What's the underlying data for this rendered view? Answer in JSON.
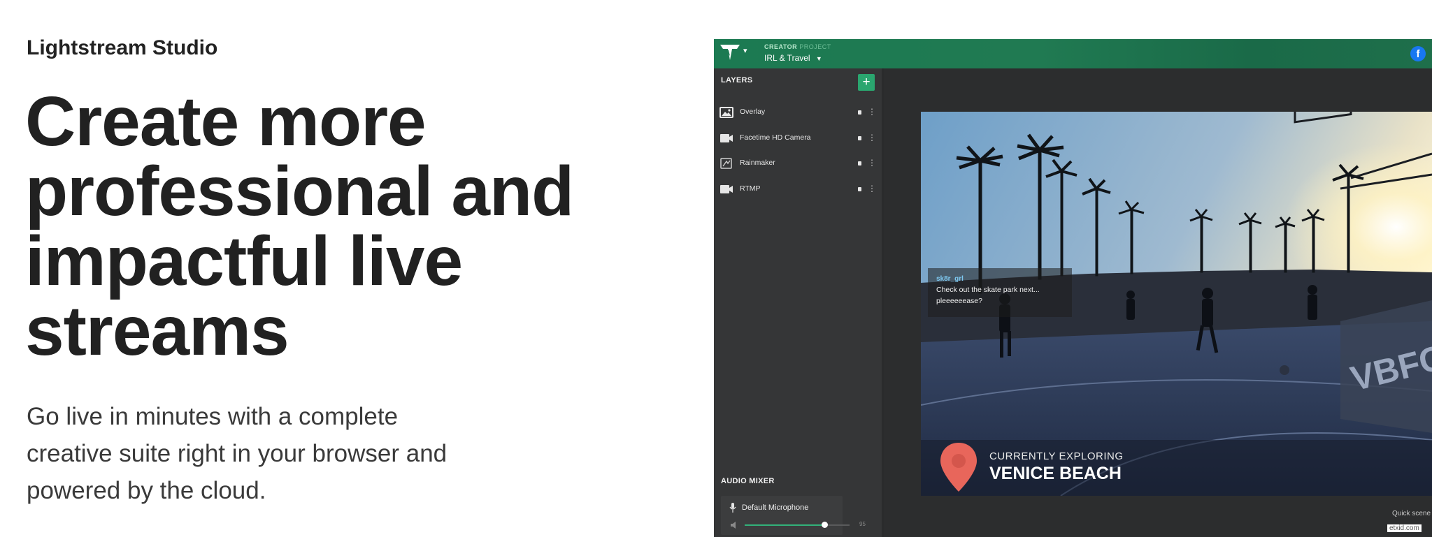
{
  "hero": {
    "eyebrow": "Lightstream Studio",
    "headline_lines": [
      "Create more",
      "professional and",
      "impactful live",
      "streams"
    ],
    "lede_lines": [
      "Go live in minutes with a complete",
      "creative suite right in your browser and",
      "powered by the cloud."
    ]
  },
  "app": {
    "project_kicker_strong": "CREATOR",
    "project_kicker_dim": "PROJECT",
    "project_name": "IRL & Travel",
    "fb_label": "f",
    "layers_title": "LAYERS",
    "add_layer_label": "+",
    "layers": [
      {
        "label": "Overlay",
        "icon": "image-icon"
      },
      {
        "label": "Facetime HD Camera",
        "icon": "video-camera-icon"
      },
      {
        "label": "Rainmaker",
        "icon": "rainmaker-icon"
      },
      {
        "label": "RTMP",
        "icon": "video-camera-icon"
      }
    ],
    "audio_mixer_title": "AUDIO MIXER",
    "mic_label": "Default Microphone",
    "mic_volume": 95,
    "mic_volume_label": "95",
    "chat_user": "sk8r_grl",
    "chat_message": "Check out the skate park next... pleeeeeease?",
    "location_kicker": "CURRENTLY EXPLORING",
    "location_name": "VENICE BEACH",
    "quick_scene": "Quick scene",
    "colors": {
      "accent": "#2aa66f",
      "topbar": "#1c7a52",
      "pin": "#e8665b",
      "facebook": "#1877f2"
    }
  },
  "watermark": "etxid.com"
}
